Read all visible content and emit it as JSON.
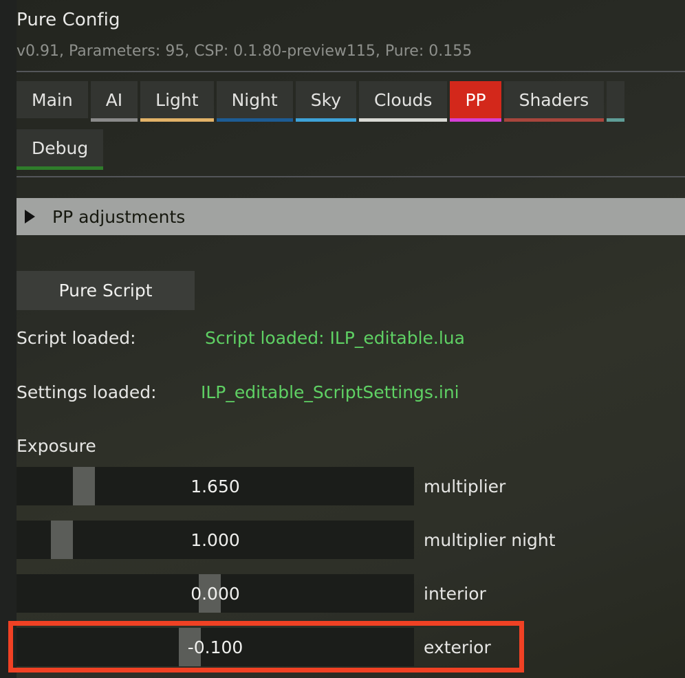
{
  "window": {
    "title": "Pure Config",
    "subtitle": "v0.91, Parameters: 95, CSP: 0.1.80-preview115, Pure: 0.155"
  },
  "tabs": {
    "row1": [
      {
        "label": "Main",
        "underline": "",
        "active": false
      },
      {
        "label": "AI",
        "underline": "#8a8a8a",
        "active": false
      },
      {
        "label": "Light",
        "underline": "#e2b268",
        "active": false
      },
      {
        "label": "Night",
        "underline": "#1d5c94",
        "active": false
      },
      {
        "label": "Sky",
        "underline": "#3ea2d8",
        "active": false
      },
      {
        "label": "Clouds",
        "underline": "#d9d9d4",
        "active": false
      },
      {
        "label": "PP",
        "underline": "#d53fd5",
        "active": true
      },
      {
        "label": "Shaders",
        "underline": "#a8453c",
        "active": false
      },
      {
        "label": "",
        "underline": "#5f9e97",
        "active": false
      }
    ],
    "row2": [
      {
        "label": "Debug",
        "underline": "#2f7d2b",
        "active": false
      }
    ]
  },
  "section": {
    "expander_icon": "triangle-right-icon",
    "label": "PP adjustments",
    "expanded": false
  },
  "script_panel": {
    "button_label": "Pure Script",
    "script_loaded_key": "Script loaded:",
    "script_loaded_value": "Script loaded: ILP_editable.lua",
    "settings_loaded_key": "Settings loaded:",
    "settings_loaded_value": "ILP_editable_ScriptSettings.ini"
  },
  "exposure": {
    "group_label": "Exposure",
    "sliders": [
      {
        "value": "1.650",
        "label": "multiplier",
        "handle_pct": 17.0,
        "highlighted": false
      },
      {
        "value": "1.000",
        "label": "multiplier night",
        "handle_pct": 11.4,
        "highlighted": false
      },
      {
        "value": "0.000",
        "label": "interior",
        "handle_pct": 48.6,
        "highlighted": false
      },
      {
        "value": "-0.100",
        "label": "exterior",
        "handle_pct": 43.6,
        "highlighted": true
      }
    ]
  },
  "colors": {
    "accent_active_tab": "#d53fd5",
    "active_tab_bg": "#d3281b",
    "highlight_border": "#f04124",
    "status_green": "#5fd164",
    "panel_bg": "#2a2c26",
    "slider_track": "#1b1d1a",
    "slider_handle": "#5b5d59",
    "section_header_bg": "#a1a3a1"
  }
}
